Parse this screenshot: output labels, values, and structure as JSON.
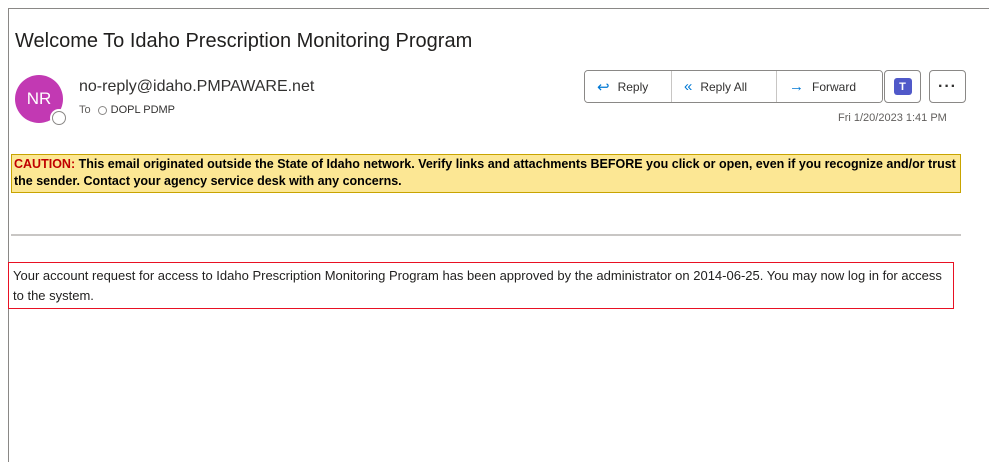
{
  "email": {
    "subject": "Welcome To Idaho Prescription Monitoring Program",
    "sender": {
      "initials": "NR",
      "address": "no-reply@idaho.PMPAWARE.net",
      "avatar_color": "#c239b3"
    },
    "to_label": "To",
    "recipient": "DOPL PDMP",
    "timestamp": "Fri 1/20/2023 1:41 PM"
  },
  "actions": {
    "reply_label": "Reply",
    "reply_all_label": "Reply All",
    "forward_label": "Forward",
    "teams_icon": "teams-icon",
    "more_label": "···"
  },
  "caution_banner": {
    "prefix": "CAUTION:",
    "text": " This email originated outside the State of Idaho network. Verify links and attachments BEFORE you click or open, even if you recognize and/or trust the sender. Contact your agency service desk with any concerns.",
    "background": "#fce794",
    "prefix_color": "#c00000"
  },
  "body": {
    "message": "Your account request for access to Idaho Prescription Monitoring Program has been approved by the administrator on 2014-06-25. You may now log in for access to the system."
  }
}
